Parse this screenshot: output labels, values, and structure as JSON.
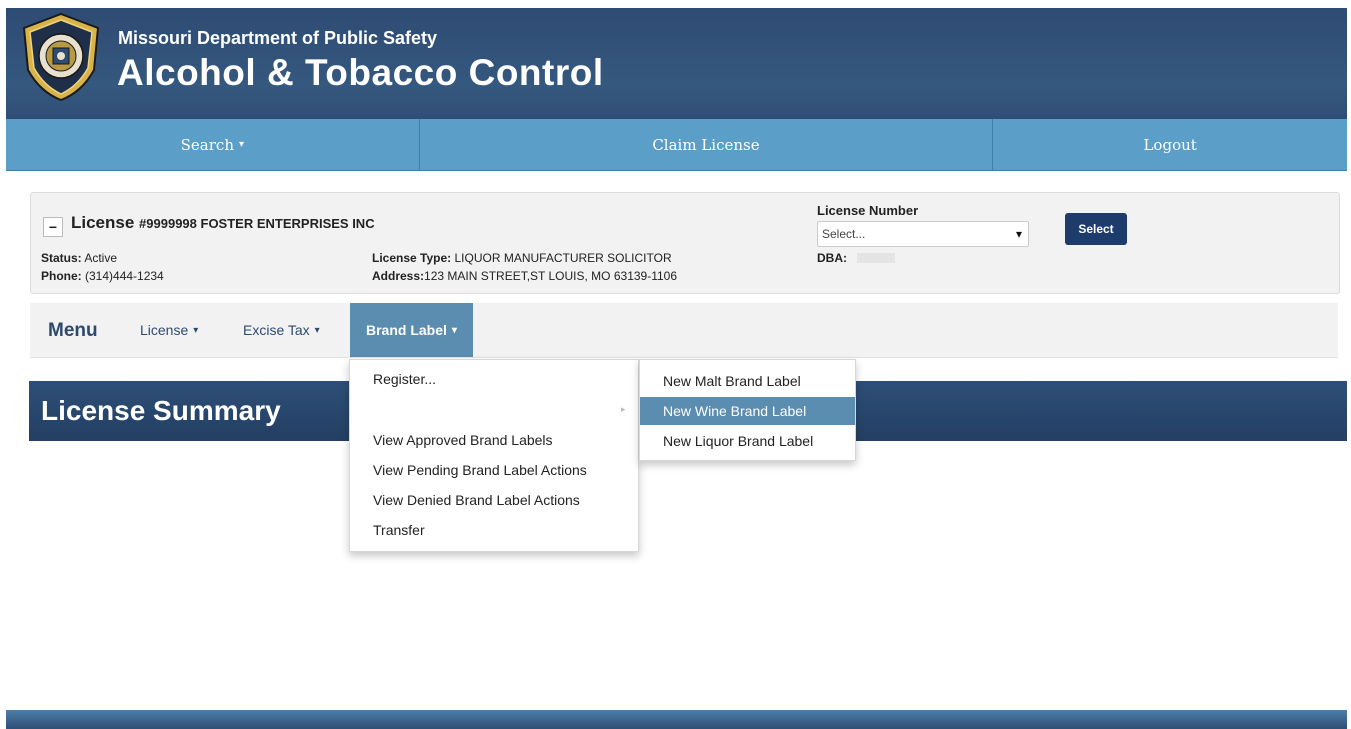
{
  "header": {
    "subtitle": "Missouri Department of Public Safety",
    "title": "Alcohol & Tobacco Control"
  },
  "topnav": {
    "search": "Search",
    "claim": "Claim License",
    "logout": "Logout"
  },
  "license": {
    "collapse_symbol": "−",
    "title_prefix": "License ",
    "title_number": "#9999998",
    "title_name": " FOSTER ENTERPRISES INC",
    "status_label": "Status:",
    "status_value": " Active",
    "phone_label": "Phone:",
    "phone_value": " (314)444-1234",
    "type_label": "License Type:",
    "type_value": " LIQUOR MANUFACTURER SOLICITOR",
    "address_label": "Address:",
    "address_value": "123 MAIN STREET,ST LOUIS, MO 63139-1106",
    "number_label": "License Number",
    "number_select": "Select...",
    "select_button": "Select",
    "dba_label": "DBA:"
  },
  "menu": {
    "label": "Menu",
    "items": [
      "License",
      "Excise Tax",
      "Brand Label"
    ]
  },
  "summary": {
    "title": "License Summary"
  },
  "dropdown": {
    "items": [
      "Register...",
      "View Approved Brand Labels",
      "View Pending Brand Label Actions",
      "View Denied Brand Label Actions",
      "Transfer"
    ]
  },
  "submenu": {
    "items": [
      "New Malt Brand Label",
      "New Wine Brand Label",
      "New Liquor Brand Label"
    ],
    "highlighted": "New Wine Brand Label"
  },
  "colors": {
    "header_bg": "#35587f",
    "topnav_bg": "#5b9ec7",
    "active_menu": "#5a8db0",
    "button_bg": "#1d3c6b"
  }
}
